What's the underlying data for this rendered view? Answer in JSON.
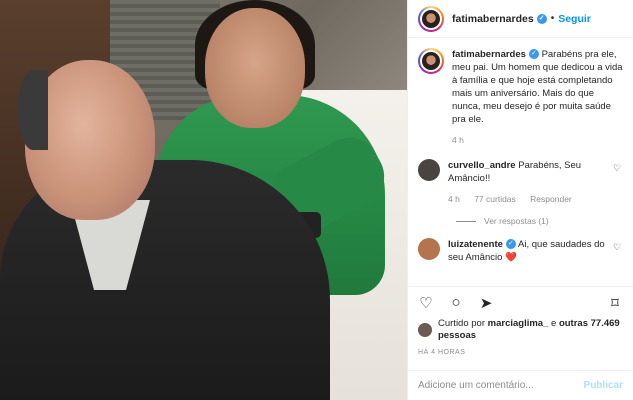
{
  "header": {
    "username": "fatimabernardes",
    "follow_label": "Seguir"
  },
  "caption": {
    "username": "fatimabernardes",
    "text": "Parabéns pra ele, meu pai. Um homem que dedicou a vida à família e que hoje está completando mais um aniversário. Mais do que nunca, meu desejo é por muita saúde pra ele.",
    "time": "4 h"
  },
  "comments": [
    {
      "username": "curvello_andre",
      "text": "Parabéns, Seu Amâncio!!",
      "time": "4 h",
      "likes": "77 curtidas",
      "reply_label": "Responder",
      "view_replies": "Ver respostas (1)"
    },
    {
      "username": "luizatenente",
      "text": "Ai, que saudades do seu Amâncio",
      "emoji": "❤️"
    }
  ],
  "likes": {
    "prefix": "Curtido por",
    "user": "marciaglima_",
    "connector": "e",
    "others": "outras 77.469 pessoas"
  },
  "post_time": "HÁ 4 HORAS",
  "comment_input": {
    "placeholder": "Adicione um comentário...",
    "publish_label": "Publicar"
  },
  "icons": {
    "like": "heart-icon",
    "comment": "comment-icon",
    "share": "share-icon",
    "save": "bookmark-icon",
    "verified": "verified-badge-icon"
  },
  "colors": {
    "link_blue": "#0095f6",
    "verified_blue": "#3897f0",
    "heart_red": "#ed4956"
  }
}
